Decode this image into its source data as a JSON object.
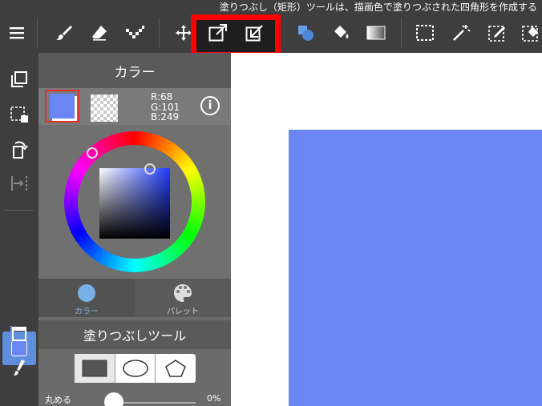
{
  "status_text": "塗りつぶし（矩形）ツールは、描画色で塗りつぶされた四角形を作成する",
  "color_panel": {
    "title": "カラー",
    "r": "R:68",
    "g": "G:101",
    "b": "B:249",
    "info": "i",
    "tabs": [
      {
        "label": "カラー"
      },
      {
        "label": "パレット"
      }
    ]
  },
  "fill_tool": {
    "title": "塗りつぶしツール",
    "round_label": "丸める",
    "round_value": "0%"
  },
  "colors": {
    "main": "#6a86f5",
    "highlight": "#ff0000"
  }
}
